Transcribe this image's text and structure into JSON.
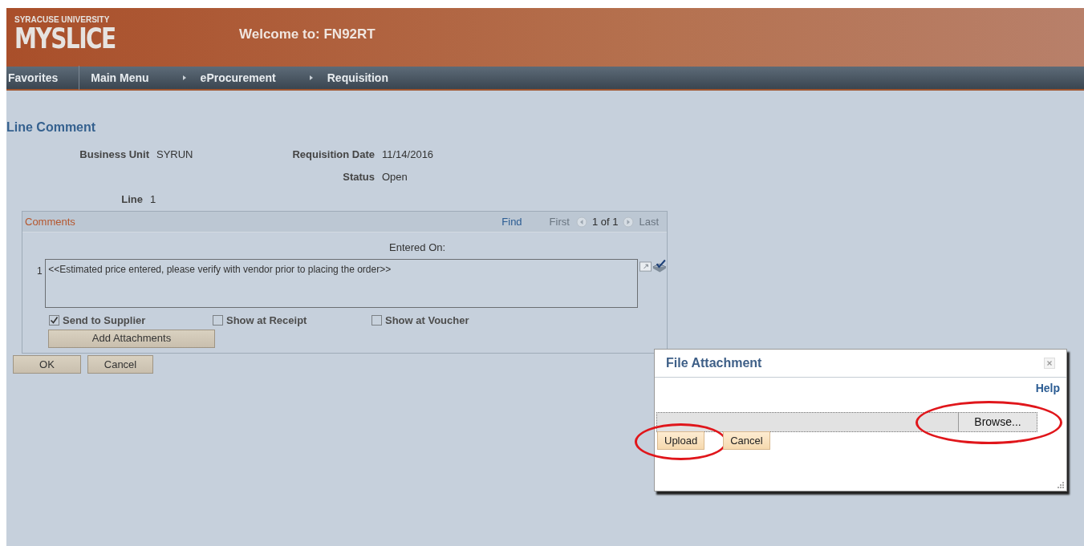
{
  "header": {
    "logo_top": "SYRACUSE UNIVERSITY",
    "logo": "MYSLICE",
    "welcome": "Welcome to: FN92RT"
  },
  "nav": [
    {
      "label": "Favorites",
      "kind": "menu"
    },
    {
      "label": "Main Menu",
      "kind": "menu"
    },
    {
      "label": "eProcurement",
      "kind": "crumb"
    },
    {
      "label": "Requisition",
      "kind": "crumb"
    }
  ],
  "page_title": "Line Comment",
  "fields": [
    {
      "label": "Business Unit",
      "value": "SYRUN"
    },
    {
      "label": "Requisition Date",
      "value": "11/14/2016"
    },
    {
      "label": "Status",
      "value": "Open"
    },
    {
      "label": "Line",
      "value": "1"
    }
  ],
  "comments": {
    "title": "Comments",
    "find": "Find",
    "first": "First",
    "count": "1 of 1",
    "last": "Last",
    "entered_on": "Entered On:",
    "rows": [
      {
        "number": "1",
        "text": "<<Estimated price entered, please verify with vendor prior to placing the order>>"
      }
    ],
    "checkboxes": [
      {
        "label": "Send to Supplier",
        "checked": true
      },
      {
        "label": "Show at Receipt",
        "checked": false
      },
      {
        "label": "Show at Voucher",
        "checked": false
      }
    ],
    "add_button": "Add Attachments"
  },
  "buttons": [
    "OK",
    "Cancel"
  ],
  "dialog": {
    "title": "File Attachment",
    "help": "Help",
    "browse": {
      "label": "Browse...",
      "highlighted": true
    },
    "buttons": [
      {
        "label": "Upload",
        "highlighted": true
      },
      {
        "label": "Cancel",
        "highlighted": false
      }
    ]
  }
}
